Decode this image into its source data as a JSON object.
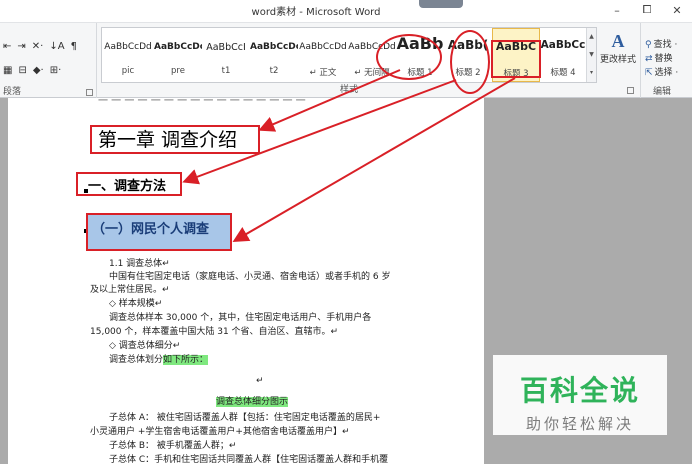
{
  "window": {
    "title": "word素材 - Microsoft Word",
    "minimize": "–",
    "maximize": "⧠",
    "close": "✕"
  },
  "ribbon": {
    "paragraph_group_label": "段落",
    "styles_group_label": "样式",
    "editing_group_label": "编辑",
    "paragraph_row1": [
      "⇤",
      "⇥",
      "✕·",
      "↓A",
      "¶"
    ],
    "paragraph_row2": [
      "▦",
      "⊟",
      "◆·",
      "⊞·"
    ],
    "styles": [
      {
        "preview": "AaBbCcDd",
        "name": "pic"
      },
      {
        "preview": "AaBbCcDc",
        "name": "pre"
      },
      {
        "preview": "AaBbCcI",
        "name": "t1"
      },
      {
        "preview": "AaBbCcDc",
        "name": "t2"
      },
      {
        "preview": "AaBbCcDd",
        "name": "↵ 正文"
      },
      {
        "preview": "AaBbCcDd",
        "name": "↵ 无间隔"
      },
      {
        "preview": "AaBb",
        "name": "标题 1"
      },
      {
        "preview": "AaBb(",
        "name": "标题 2"
      },
      {
        "preview": "AaBbC",
        "name": "标题 3"
      },
      {
        "preview": "AaBbCc",
        "name": "标题 4"
      }
    ],
    "change_styles_label": "更改样式",
    "change_styles_icon": "A",
    "find_label": "查找 ·",
    "replace_label": "替换",
    "select_label": "选择 ·"
  },
  "document": {
    "top_cut_text": "一 一 一 一 一 一 一 一 一 一 一 一 一 一 一 一",
    "heading1": "第一章  调查介绍",
    "heading2": "一、调查方法",
    "heading3": "（一）网民个人调查",
    "lines": [
      "1.1  调查总体↵",
      "中国有住宅固定电话（家庭电话、小灵通、宿舍电话）或者手机的 6 岁",
      "及以上常住居民。↵",
      "◇  样本规模↵",
      "调查总体样本 30,000 个，其中，住宅固定电话用户、手机用户各",
      "15,000 个，样本覆盖中国大陆 31 个省、自治区、直辖市。↵",
      "◇  调查总体细分↵",
      "调查总体划分",
      "如下所示：",
      "↵",
      "调查总体细分图示",
      "子总体 A：  被住宅固话覆盖人群【包括：住宅固定电话覆盖的居民+",
      "小灵通用户 +学生宿舍电话覆盖用户+其他宿舍电话覆盖用户】↵",
      "子总体 B：  被手机覆盖人群；↵",
      "子总体 C：手机和住宅固话共同覆盖人群【住宅固话覆盖人群和手机覆"
    ]
  },
  "watermark": {
    "big": "百科全说",
    "small": "助你轻松解决"
  },
  "colors": {
    "annotation_red": "#d92027",
    "heading3_highlight": "#a8c6e8",
    "text_highlight": "#7fe87f",
    "watermark_green": "#2fb35a"
  }
}
